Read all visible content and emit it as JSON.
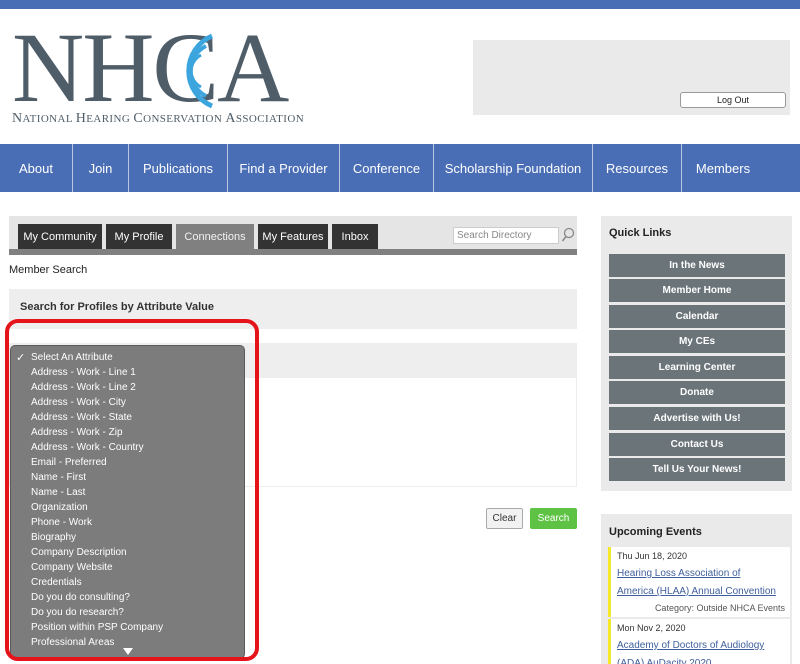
{
  "logo": {
    "letters": "NHCA",
    "subtitle_caps": [
      "N",
      "H",
      "C",
      "A"
    ],
    "subtitle_rest": [
      "ATIONAL ",
      "EARING ",
      "ONSERVATION ",
      "SSOCIATION"
    ]
  },
  "account": {
    "logout_label": "Log Out"
  },
  "nav": {
    "items": [
      "About",
      "Join",
      "Publications",
      "Find a Provider",
      "Conference",
      "Scholarship Foundation",
      "Resources",
      "Members"
    ]
  },
  "community": {
    "tabs": [
      "My Community",
      "My Profile",
      "Connections",
      "My Features",
      "Inbox"
    ],
    "active_tab": "Connections",
    "search_placeholder": "Search Directory",
    "member_search_label": "Member Search",
    "section_title": "Search for Profiles by Attribute Value",
    "clear_label": "Clear",
    "search_label": "Search"
  },
  "dropdown": {
    "selected": "Select An Attribute",
    "options": [
      "Select An Attribute",
      "Address - Work - Line 1",
      "Address - Work - Line 2",
      "Address - Work - City",
      "Address - Work - State",
      "Address - Work - Zip",
      "Address - Work - Country",
      "Email - Preferred",
      "Name - First",
      "Name - Last",
      "Organization",
      "Phone - Work",
      "Biography",
      "Company Description",
      "Company Website",
      "Credentials",
      "Do you do consulting?",
      "Do you do research?",
      "Position within PSP Company",
      "Professional Areas"
    ]
  },
  "quick_links": {
    "title": "Quick Links",
    "items": [
      "In the News",
      "Member Home",
      "Calendar",
      "My CEs",
      "Learning Center",
      "Donate",
      "Advertise with Us!",
      "Contact Us",
      "Tell Us Your News!"
    ]
  },
  "events": {
    "title": "Upcoming Events",
    "items": [
      {
        "date": "Thu Jun 18, 2020",
        "line1": "Hearing Loss Association of",
        "line2": "America (HLAA) Annual Convention",
        "category": "Category: Outside NHCA Events"
      },
      {
        "date": "Mon Nov 2, 2020",
        "line1": "Academy of Doctors of Audiology",
        "line2": "(ADA) AuDacity 2020",
        "category": ""
      }
    ]
  },
  "colors": {
    "brand_blue": "#4a6eb5",
    "dark_tab": "#333333",
    "button_gray": "#6b7479",
    "search_green": "#5ec345",
    "event_accent": "#f5ea2a",
    "highlight_red": "#e5141b"
  }
}
